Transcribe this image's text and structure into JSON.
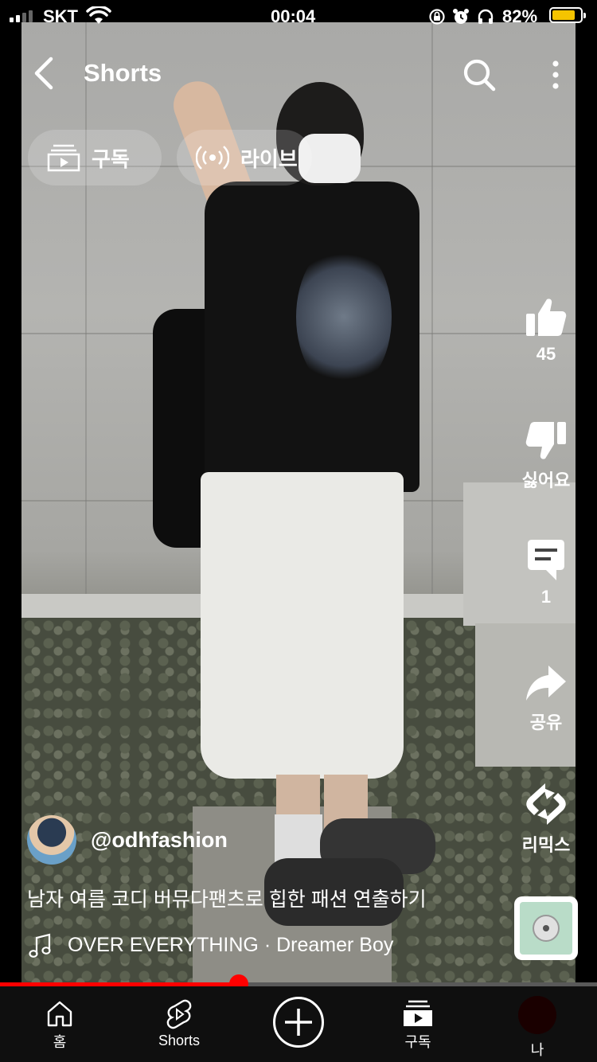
{
  "status_bar": {
    "carrier": "SKT",
    "time": "00:04",
    "battery_percent": "82%",
    "battery_level": 0.82,
    "battery_color": "#f5c400"
  },
  "header": {
    "title": "Shorts",
    "back_icon": "chevron-left-icon",
    "search_icon": "search-icon",
    "more_icon": "more-vertical-icon"
  },
  "chips": [
    {
      "label": "구독",
      "icon": "subscriptions-icon"
    },
    {
      "label": "라이브",
      "icon": "live-broadcast-icon"
    }
  ],
  "actions": {
    "like_count": "45",
    "dislike_label": "싫어요",
    "comment_count": "1",
    "share_label": "공유",
    "remix_label": "리믹스"
  },
  "video_info": {
    "channel_handle": "@odhfashion",
    "description": "남자 여름 코디 버뮤다팬츠로 힙한 패션 연출하기",
    "music": "OVER EVERYTHING · Dreamer Boy"
  },
  "playback": {
    "progress": 0.4,
    "progress_color": "#ff0000"
  },
  "nav": [
    {
      "label": "홈",
      "icon": "home-icon"
    },
    {
      "label": "Shorts",
      "icon": "shorts-icon"
    },
    {
      "label": "",
      "icon": "create-plus-icon"
    },
    {
      "label": "구독",
      "icon": "subscriptions-icon"
    },
    {
      "label": "나",
      "icon": "profile-avatar"
    }
  ]
}
